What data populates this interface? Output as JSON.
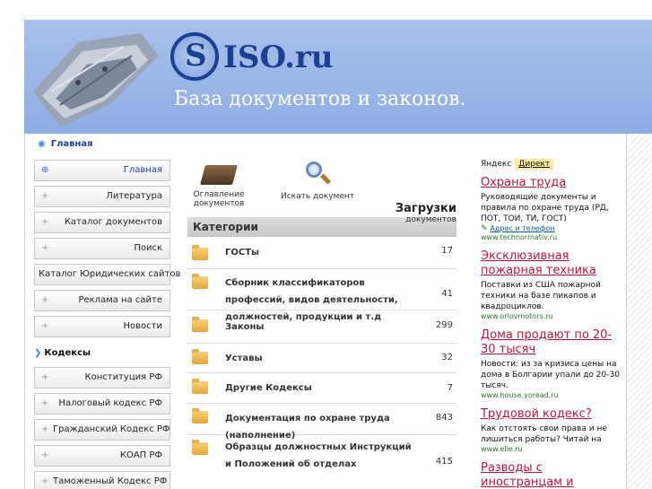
{
  "banner": {
    "logo_letter": "S",
    "logo_text": "ISO.ru",
    "tagline": "База документов и законов."
  },
  "breadcrumb": {
    "label": "Главная"
  },
  "sidebar": {
    "main_items": [
      {
        "label": "Главная"
      },
      {
        "label": "Литература"
      },
      {
        "label": "Каталог документов"
      },
      {
        "label": "Поиск"
      },
      {
        "label": "Каталог Юридических сайтов"
      },
      {
        "label": "Реклама на сайте"
      },
      {
        "label": "Новости"
      }
    ],
    "group_title": "Кодексы",
    "code_items": [
      {
        "label": "Конституция РФ"
      },
      {
        "label": "Налоговый кодекс РФ"
      },
      {
        "label": "Гражданский Кодекс РФ"
      },
      {
        "label": "КОАП РФ"
      },
      {
        "label": "Таможенный Кодекс РФ"
      }
    ]
  },
  "main": {
    "toc_label": "Оглавление документов",
    "search_label": "Искать документ",
    "downloads_big": "Загрузки",
    "downloads_small": "документов",
    "categories_title": "Категории",
    "categories": [
      {
        "name": "ГОСТы",
        "count": "17"
      },
      {
        "name": "Сборник классификаторов профессий, видов деятельности, должностей, продукции и т.д",
        "count": "41"
      },
      {
        "name": "Законы",
        "count": "299"
      },
      {
        "name": "Уставы",
        "count": "32"
      },
      {
        "name": "Другие Кодексы",
        "count": "7"
      },
      {
        "name": "Документация по охране труда (наполнение)",
        "count": "843"
      },
      {
        "name": "Образцы должностных Инструкций и Положений об отделах",
        "count": "415"
      }
    ]
  },
  "ads": {
    "yandex": "Яндекс",
    "direct": "Директ",
    "items": [
      {
        "title": "Охрана труда",
        "text": "Руководящие документы и правила по охране труда (РД, ПОТ, ТОИ, ТИ, ГОСТ)",
        "addr": "Адрес и телефон",
        "url": "www.technormativ.ru"
      },
      {
        "title": "Эксклюзивная пожарная техника",
        "text": "Поставки из США пожарной техники на базе пикапов и квадроциклов.",
        "addr": "",
        "url": "www.orlovmotors.ru"
      },
      {
        "title": "Дома продают по 20-30 тысяч",
        "text": "Новости: из за кризиса цены на дома в Болгарии упали до 20-30 тысяч.",
        "addr": "",
        "url": "www.house.yoread.ru"
      },
      {
        "title": "Трудовой кодекс?",
        "text": "Как отстоять свои права и не лишиться работы? Читай на",
        "addr": "",
        "url": "www.elle.ru"
      },
      {
        "title": "Разводы с иностранцам и",
        "text": "",
        "addr": "",
        "url": ""
      }
    ]
  },
  "colors": {
    "banner": "#8eaee4",
    "logo": "#1d3f92",
    "ad_title": "#c0143c",
    "ad_url": "#2a7a2a"
  }
}
